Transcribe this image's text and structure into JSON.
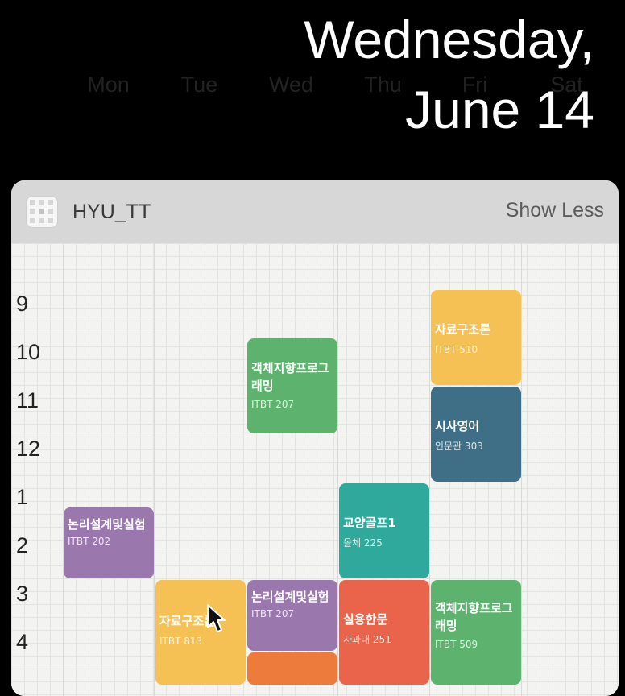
{
  "date": {
    "line1": "Wednesday,",
    "line2": "June 14"
  },
  "widget": {
    "app_name": "HYU_TT",
    "show_less_label": "Show Less",
    "icon": "grid-app-icon"
  },
  "days": [
    "Mon",
    "Tue",
    "Wed",
    "Thu",
    "Fri",
    "Sat"
  ],
  "hours": [
    "9",
    "10",
    "11",
    "12",
    "1",
    "2",
    "3",
    "4"
  ],
  "events": [
    {
      "title": "자료구조론",
      "room": "ITBT 510",
      "day": "Fri",
      "color": "#f5c154"
    },
    {
      "title": "객체지향프로그래밍",
      "room": "ITBT 207",
      "day": "Wed",
      "color": "#5db36e"
    },
    {
      "title": "시사영어",
      "room": "인문관 303",
      "day": "Fri",
      "color": "#3f6f86"
    },
    {
      "title": "교양골프1",
      "room": "올체 225",
      "day": "Thu",
      "color": "#2fa99c"
    },
    {
      "title": "논리설계및실험",
      "room": "ITBT 202",
      "day": "Mon",
      "color": "#9a78ad"
    },
    {
      "title": "자료구조론",
      "room": "ITBT 813",
      "day": "Tue",
      "color": "#f5c154"
    },
    {
      "title": "논리설계및실험",
      "room": "ITBT 207",
      "day": "Wed",
      "color": "#9a78ad"
    },
    {
      "title": "실용한문",
      "room": "사과대 251",
      "day": "Thu",
      "color": "#e9644a"
    },
    {
      "title": "객체지향프로그래밍",
      "room": "ITBT 509",
      "day": "Fri",
      "color": "#5db36e"
    },
    {
      "title": "",
      "room": "",
      "day": "Wed",
      "color": "#ec7b3c"
    }
  ]
}
